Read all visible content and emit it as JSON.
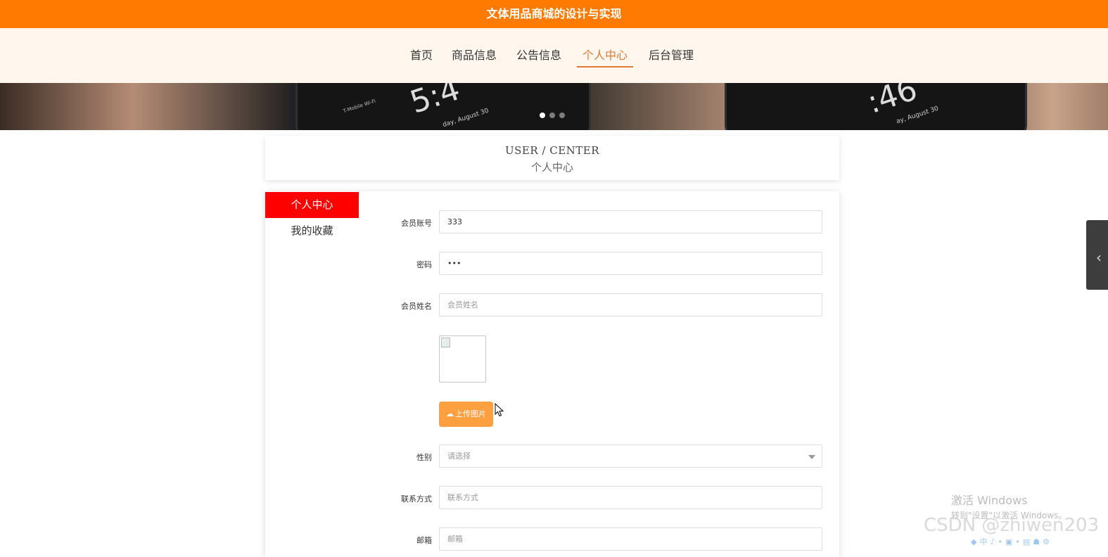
{
  "header": {
    "title": "文体用品商城的设计与实现"
  },
  "nav": {
    "items": [
      {
        "label": "首页"
      },
      {
        "label": "商品信息"
      },
      {
        "label": "公告信息"
      },
      {
        "label": "个人中心"
      },
      {
        "label": "后台管理"
      }
    ],
    "active_index": 3
  },
  "banner": {
    "phone_left_time": "5:4",
    "phone_left_subtext": "day, August 30",
    "phone_left_carrier": "T-Mobile Wi-Fi",
    "phone_right_time": ":46",
    "phone_right_subtext": "ay, August 30",
    "carousel_total": 3,
    "carousel_active": 1
  },
  "section": {
    "title_en": "USER / CENTER",
    "title_cn": "个人中心"
  },
  "sidebar": {
    "items": [
      {
        "label": "个人中心"
      },
      {
        "label": "我的收藏"
      }
    ],
    "active_index": 0
  },
  "form": {
    "account_label": "会员账号",
    "account_value": "333",
    "password_label": "密码",
    "password_value": "•••",
    "name_label": "会员姓名",
    "name_placeholder": "会员姓名",
    "upload_label": "上传图片",
    "gender_label": "性别",
    "gender_placeholder": "请选择",
    "contact_label": "联系方式",
    "contact_placeholder": "联系方式",
    "email_label": "邮箱",
    "email_placeholder": "邮箱"
  },
  "watermark": {
    "windows_title": "激活 Windows",
    "windows_sub": "转到\"设置\"以激活 Windows。",
    "csdn": "CSDN @zhiwen203"
  },
  "colors": {
    "topbar": "#ff7a00",
    "nav_bg": "#fff7ee",
    "nav_active": "#e07a33",
    "sidebar_active": "#ff0000",
    "upload_button": "#ffa040"
  }
}
